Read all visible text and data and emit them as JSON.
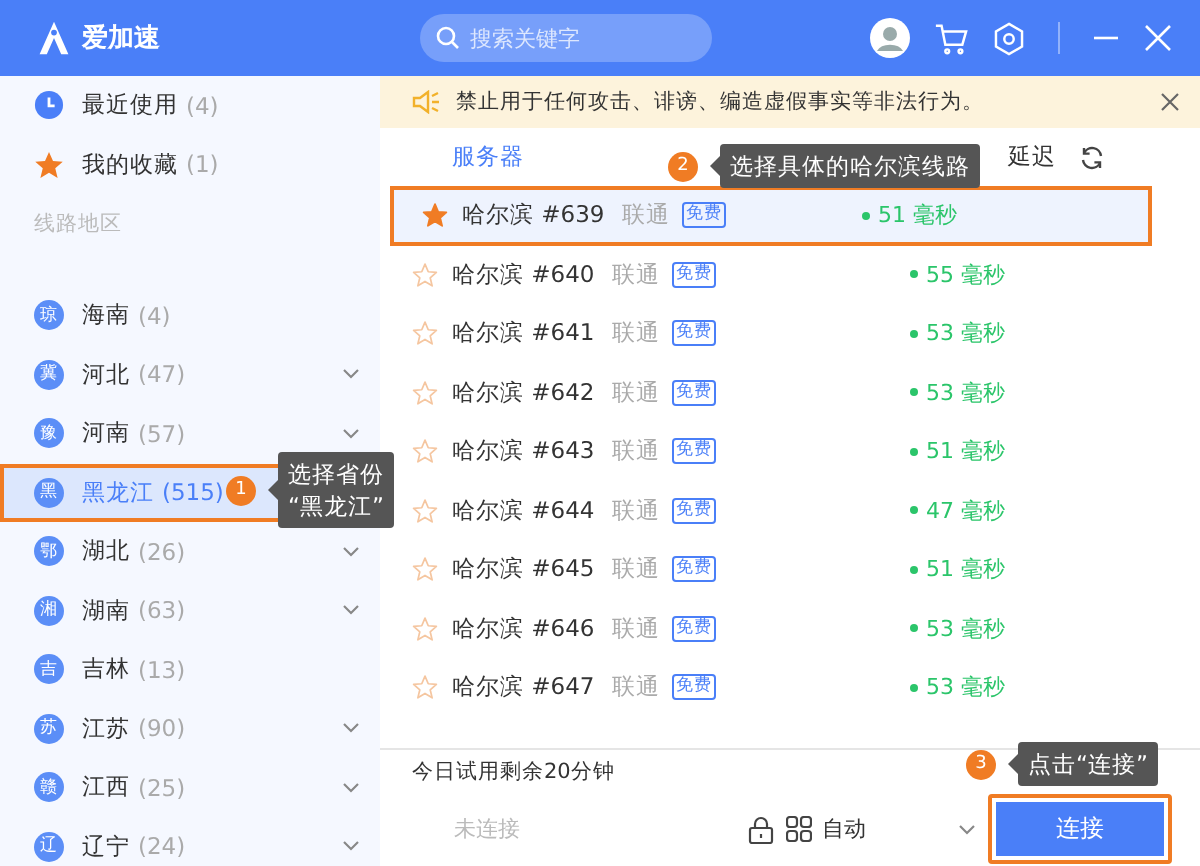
{
  "app": {
    "name": "爱加速"
  },
  "search": {
    "placeholder": "搜索关键字"
  },
  "sidebar": {
    "quick": [
      {
        "kind": "recent",
        "label": "最近使用",
        "count": "(4)"
      },
      {
        "kind": "favorite",
        "label": "我的收藏",
        "count": "(1)"
      }
    ],
    "section": "线路地区",
    "regions": [
      {
        "badge": "琼",
        "name": "海南",
        "count": "(4)",
        "expandable": false,
        "selected": false,
        "highlighted": false
      },
      {
        "badge": "冀",
        "name": "河北",
        "count": "(47)",
        "expandable": true,
        "selected": false,
        "highlighted": false
      },
      {
        "badge": "豫",
        "name": "河南",
        "count": "(57)",
        "expandable": true,
        "selected": false,
        "highlighted": false
      },
      {
        "badge": "黑",
        "name": "黑龙江",
        "count": "(515)",
        "expandable": false,
        "selected": true,
        "highlighted": true
      },
      {
        "badge": "鄂",
        "name": "湖北",
        "count": "(26)",
        "expandable": true,
        "selected": false,
        "highlighted": false
      },
      {
        "badge": "湘",
        "name": "湖南",
        "count": "(63)",
        "expandable": true,
        "selected": false,
        "highlighted": false
      },
      {
        "badge": "吉",
        "name": "吉林",
        "count": "(13)",
        "expandable": false,
        "selected": false,
        "highlighted": false
      },
      {
        "badge": "苏",
        "name": "江苏",
        "count": "(90)",
        "expandable": true,
        "selected": false,
        "highlighted": false
      },
      {
        "badge": "赣",
        "name": "江西",
        "count": "(25)",
        "expandable": true,
        "selected": false,
        "highlighted": false
      },
      {
        "badge": "辽",
        "name": "辽宁",
        "count": "(24)",
        "expandable": true,
        "selected": false,
        "highlighted": false
      }
    ]
  },
  "notice": {
    "text": "禁止用于任何攻击、诽谤、编造虚假事实等非法行为。"
  },
  "table": {
    "columns": [
      "服务器",
      "延迟"
    ],
    "rows": [
      {
        "name": "哈尔滨 #639",
        "isp": "联通",
        "tag": "免费",
        "latency": "51 毫秒",
        "favorite": true,
        "selected": true,
        "highlighted": true
      },
      {
        "name": "哈尔滨 #640",
        "isp": "联通",
        "tag": "免费",
        "latency": "55 毫秒",
        "favorite": false,
        "selected": false,
        "highlighted": false
      },
      {
        "name": "哈尔滨 #641",
        "isp": "联通",
        "tag": "免费",
        "latency": "53 毫秒",
        "favorite": false,
        "selected": false,
        "highlighted": false
      },
      {
        "name": "哈尔滨 #642",
        "isp": "联通",
        "tag": "免费",
        "latency": "53 毫秒",
        "favorite": false,
        "selected": false,
        "highlighted": false
      },
      {
        "name": "哈尔滨 #643",
        "isp": "联通",
        "tag": "免费",
        "latency": "51 毫秒",
        "favorite": false,
        "selected": false,
        "highlighted": false
      },
      {
        "name": "哈尔滨 #644",
        "isp": "联通",
        "tag": "免费",
        "latency": "47 毫秒",
        "favorite": false,
        "selected": false,
        "highlighted": false
      },
      {
        "name": "哈尔滨 #645",
        "isp": "联通",
        "tag": "免费",
        "latency": "51 毫秒",
        "favorite": false,
        "selected": false,
        "highlighted": false
      },
      {
        "name": "哈尔滨 #646",
        "isp": "联通",
        "tag": "免费",
        "latency": "53 毫秒",
        "favorite": false,
        "selected": false,
        "highlighted": false
      },
      {
        "name": "哈尔滨 #647",
        "isp": "联通",
        "tag": "免费",
        "latency": "53 毫秒",
        "favorite": false,
        "selected": false,
        "highlighted": false
      }
    ]
  },
  "footer": {
    "trial": "今日试用剩余20分钟",
    "status": "未连接",
    "mode": "自动",
    "connect": {
      "label": "连接",
      "highlighted": true
    }
  },
  "annotations": [
    {
      "number": "1",
      "lines": [
        "选择省份",
        "“黑龙江”"
      ]
    },
    {
      "number": "2",
      "lines": [
        "选择具体的哈尔滨线路"
      ]
    },
    {
      "number": "3",
      "lines": [
        "点击“连接”"
      ]
    }
  ]
}
